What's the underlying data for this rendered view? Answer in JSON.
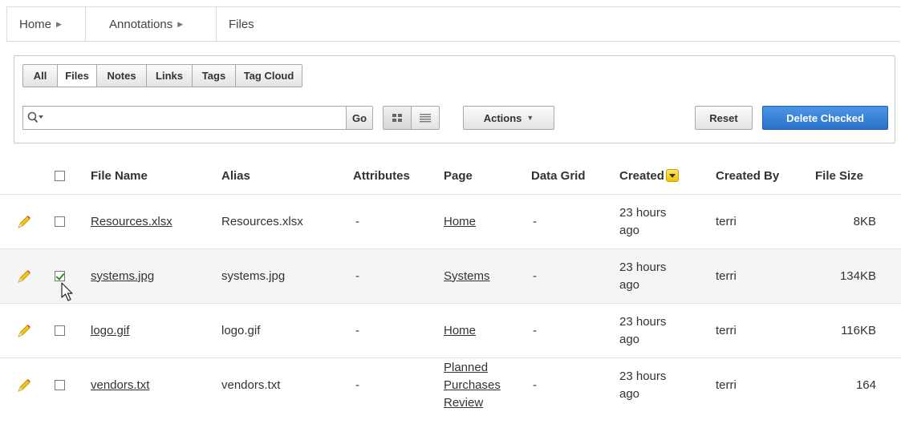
{
  "breadcrumb": [
    {
      "label": "Home",
      "arrow": "▶"
    },
    {
      "label": "Annotations",
      "arrow": "▶"
    },
    {
      "label": "Files"
    }
  ],
  "tabs": [
    {
      "label": "All",
      "active": false
    },
    {
      "label": "Files",
      "active": true
    },
    {
      "label": "Notes",
      "active": false
    },
    {
      "label": "Links",
      "active": false
    },
    {
      "label": "Tags",
      "active": false
    },
    {
      "label": "Tag Cloud",
      "active": false
    }
  ],
  "search": {
    "value": "",
    "placeholder": "",
    "go_label": "Go",
    "icon": "search-icon"
  },
  "toolbar": {
    "actions_label": "Actions",
    "actions_caret": "▼",
    "reset_label": "Reset",
    "delete_label": "Delete Checked",
    "view_icons": [
      "grid-view-icon",
      "list-view-icon"
    ]
  },
  "table": {
    "headers": {
      "file_name": "File Name",
      "alias": "Alias",
      "attributes": "Attributes",
      "page": "Page",
      "data_grid": "Data Grid",
      "created": "Created",
      "created_by": "Created By",
      "file_size": "File Size"
    },
    "sort_icon": "sort-descending-icon",
    "rows": [
      {
        "file_name": "Resources.xlsx",
        "alias": "Resources.xlsx",
        "attributes": "-",
        "page": "Home",
        "data_grid": "-",
        "created": "23 hours ago",
        "created_by": "terri",
        "file_size": "8KB",
        "checked": false
      },
      {
        "file_name": "systems.jpg",
        "alias": "systems.jpg",
        "attributes": "-",
        "page": "Systems",
        "data_grid": "-",
        "created": "23 hours ago",
        "created_by": "terri",
        "file_size": "134KB",
        "checked": true
      },
      {
        "file_name": "logo.gif",
        "alias": "logo.gif",
        "attributes": "-",
        "page": "Home",
        "data_grid": "-",
        "created": "23 hours ago",
        "created_by": "terri",
        "file_size": "116KB",
        "checked": false
      },
      {
        "file_name": "vendors.txt",
        "alias": "vendors.txt",
        "attributes": "-",
        "page": "Planned Purchases Review",
        "data_grid": "-",
        "created": "23 hours ago",
        "created_by": "terri",
        "file_size": "164",
        "checked": false
      }
    ]
  },
  "colors": {
    "accent": "#2a72c9",
    "sort_highlight": "#f2c100",
    "check": "#2a8b2a",
    "pencil": "#e8b400"
  }
}
